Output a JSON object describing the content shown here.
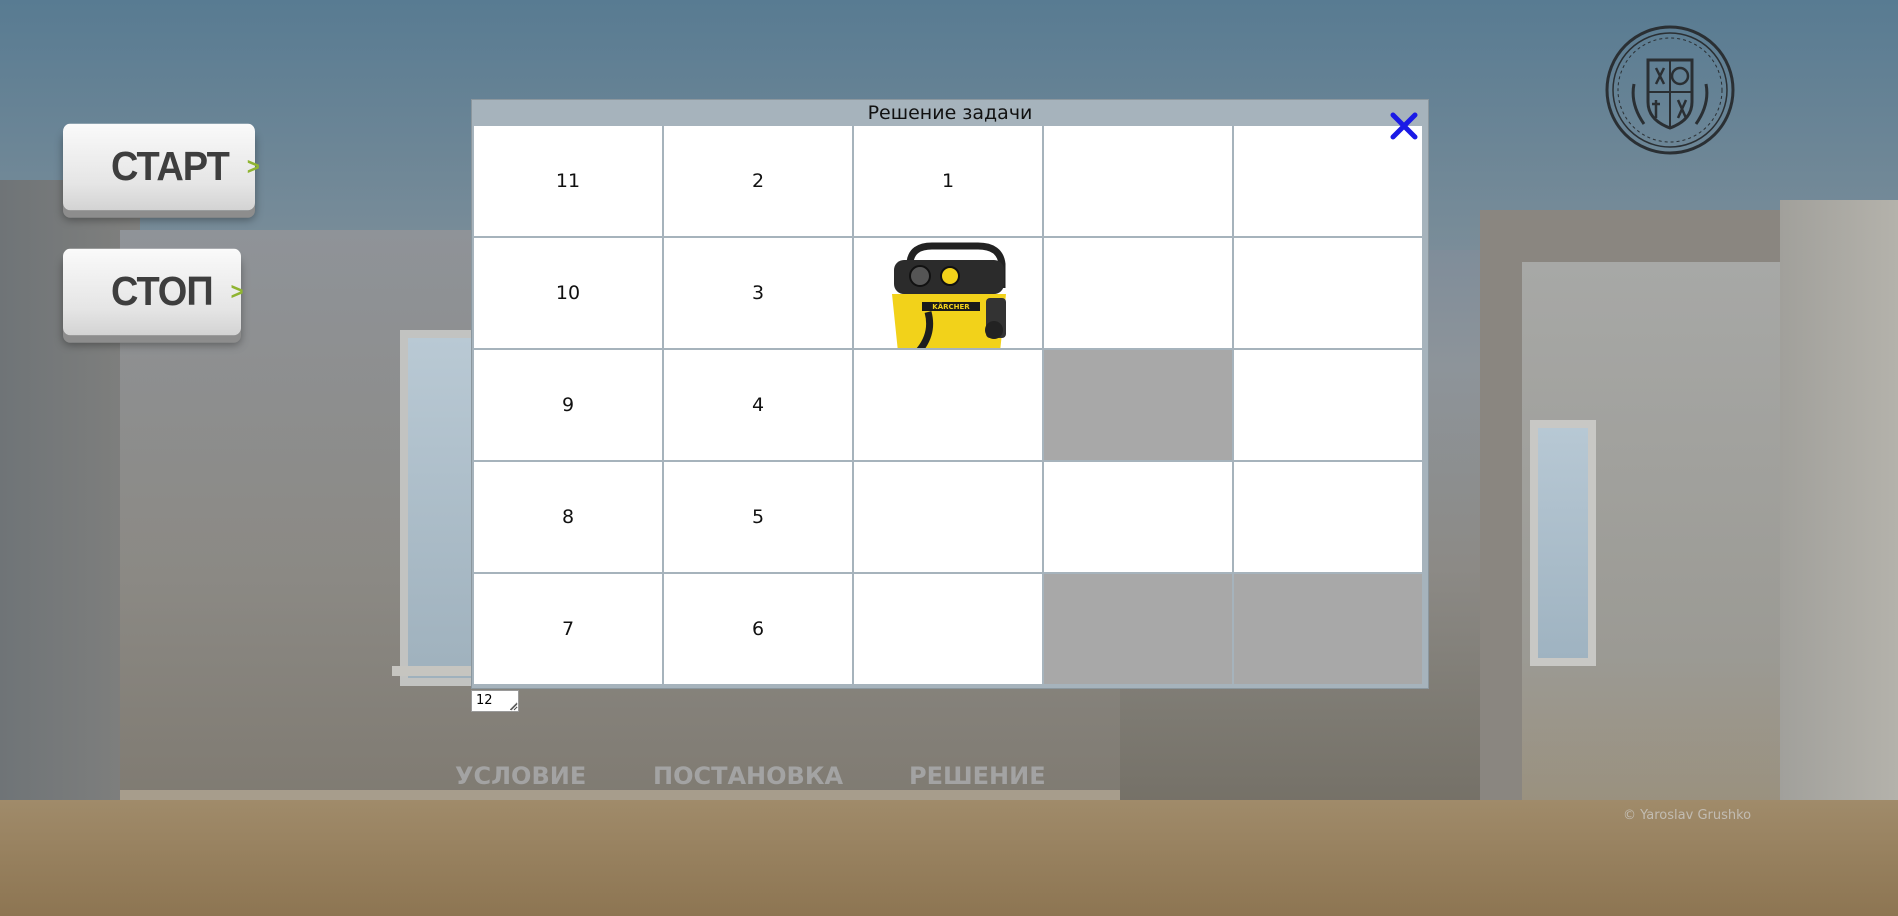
{
  "sidebar": {
    "start_label": "СТАРТ",
    "stop_label": "СТОП",
    "arrow": ">"
  },
  "dialog": {
    "title": "Решение задачи",
    "close_icon": "close-x-icon",
    "grid": [
      [
        "11",
        "2",
        "1",
        "",
        ""
      ],
      [
        "10",
        "3",
        "",
        "",
        ""
      ],
      [
        "9",
        "4",
        "",
        "",
        ""
      ],
      [
        "8",
        "5",
        "",
        "",
        ""
      ],
      [
        "7",
        "6",
        "",
        "",
        ""
      ]
    ],
    "shaded_cells": [
      [
        2,
        3
      ],
      [
        4,
        3
      ],
      [
        4,
        4
      ]
    ],
    "robot_cell": [
      1,
      2
    ],
    "robot_icon": "vacuum-cleaner-icon",
    "robot_brand": "KÄRCHER"
  },
  "step_input": {
    "value": "12"
  },
  "nav": {
    "condition": "УСЛОВИЕ",
    "statement": "ПОСТАНОВКА",
    "solution": "РЕШЕНИЕ"
  },
  "copyright": "© Yaroslav Grushko",
  "colors": {
    "close_icon": "#1a1ae6",
    "shaded_cell": "#a8a8a8",
    "arrow_accent": "#8fb431",
    "nav_text": "#a3a3a3",
    "vacuum_body": "#f2d21a"
  }
}
